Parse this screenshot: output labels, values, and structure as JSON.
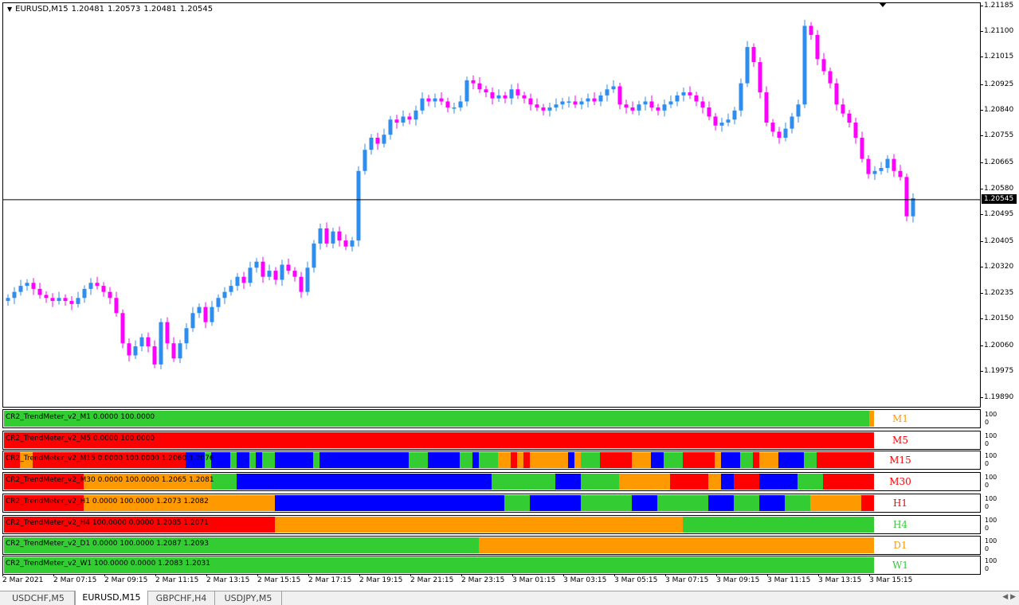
{
  "chart": {
    "symbol": "EURUSD,M15",
    "ohlc": [
      "1.20481",
      "1.20573",
      "1.20481",
      "1.20545"
    ],
    "current_price": "1.20545",
    "up_color": "#2e8ef0",
    "down_color": "#ff00ff",
    "y_min": 1.1986,
    "y_max": 1.21195,
    "y_ticks": [
      "1.21185",
      "1.21100",
      "1.21015",
      "1.20925",
      "1.20840",
      "1.20755",
      "1.20665",
      "1.20580",
      "1.20495",
      "1.20405",
      "1.20320",
      "1.20235",
      "1.20150",
      "1.20060",
      "1.19975",
      "1.19890"
    ]
  },
  "chart_data": {
    "type": "candlestick",
    "title": "EURUSD,M15",
    "ylim": [
      1.1986,
      1.21195
    ],
    "last_price": 1.20545,
    "x_labels": [
      "2 Mar 2021",
      "2 Mar 07:15",
      "2 Mar 09:15",
      "2 Mar 11:15",
      "2 Mar 13:15",
      "2 Mar 15:15",
      "2 Mar 17:15",
      "2 Mar 19:15",
      "2 Mar 21:15",
      "2 Mar 23:15",
      "3 Mar 01:15",
      "3 Mar 03:15",
      "3 Mar 05:15",
      "3 Mar 07:15",
      "3 Mar 09:15",
      "3 Mar 11:15",
      "3 Mar 13:15",
      "3 Mar 15:15"
    ],
    "closes": [
      1.2022,
      1.2024,
      1.2026,
      1.2027,
      1.2025,
      1.2023,
      1.2022,
      1.2021,
      1.2022,
      1.2021,
      1.202,
      1.2022,
      1.2025,
      1.2027,
      1.2026,
      1.2024,
      1.2022,
      1.2017,
      1.2007,
      1.2003,
      1.2006,
      1.2009,
      1.2006,
      1.2,
      1.2014,
      1.2007,
      1.2002,
      1.2007,
      1.2012,
      1.2017,
      1.2019,
      1.2014,
      1.2019,
      1.2022,
      1.2024,
      1.2026,
      1.2029,
      1.2027,
      1.2032,
      1.2034,
      1.2029,
      1.2031,
      1.2028,
      1.2033,
      1.2031,
      1.2029,
      1.2024,
      1.2032,
      1.204,
      1.2045,
      1.204,
      1.2044,
      1.2041,
      1.2039,
      1.2041,
      1.2064,
      1.2071,
      1.2075,
      1.2073,
      1.2076,
      1.2081,
      1.208,
      1.2082,
      1.2081,
      1.2084,
      1.2088,
      1.2087,
      1.2088,
      1.2087,
      1.2085,
      1.2085,
      1.2087,
      1.2094,
      1.2093,
      1.2091,
      1.209,
      1.2088,
      1.2089,
      1.2088,
      1.2091,
      1.2089,
      1.2088,
      1.2086,
      1.2085,
      1.2084,
      1.2085,
      1.2086,
      1.2087,
      1.2087,
      1.2086,
      1.2087,
      1.2088,
      1.2087,
      1.2089,
      1.2091,
      1.2092,
      1.2086,
      1.2085,
      1.2084,
      1.2086,
      1.2087,
      1.2085,
      1.2084,
      1.2086,
      1.2087,
      1.2089,
      1.209,
      1.2089,
      1.2087,
      1.2085,
      1.2082,
      1.2079,
      1.208,
      1.2081,
      1.2084,
      1.2093,
      1.2105,
      1.21,
      1.209,
      1.208,
      1.2077,
      1.2075,
      1.2078,
      1.2082,
      1.2086,
      1.2112,
      1.2109,
      1.2101,
      1.2097,
      1.2093,
      1.2086,
      1.2083,
      1.208,
      1.2075,
      1.2068,
      1.2063,
      1.2064,
      1.2065,
      1.2068,
      1.2064,
      1.2062,
      1.2049,
      1.2055
    ]
  },
  "indicators": [
    {
      "label": "CR2_TrendMeter_v2_M1 0.0000 100.0000",
      "tf": "M1",
      "tf_color": "#ff9900",
      "scale": [
        "100",
        "0"
      ],
      "segments": [
        [
          0,
          1086,
          "#33cc33"
        ],
        [
          1086,
          1092,
          "#ff9900"
        ]
      ]
    },
    {
      "label": "CR2_TrendMeter_v2_M5 0.0000 100.0000",
      "tf": "M5",
      "tf_color": "#ff0000",
      "scale": [
        "100",
        "0"
      ],
      "segments": [
        [
          0,
          1092,
          "#ff0000"
        ]
      ]
    },
    {
      "label": "CR2_TrendMeter_v2_M15 0.0000 100.0000 1.2060 1.2076",
      "tf": "M15",
      "tf_color": "#ff0000",
      "scale": [
        "100",
        "0"
      ],
      "segments": [
        [
          0,
          20,
          "#ff0000"
        ],
        [
          20,
          36,
          "#ff9900"
        ],
        [
          36,
          228,
          "#ff0000"
        ],
        [
          228,
          252,
          "#0000ff"
        ],
        [
          252,
          260,
          "#33cc33"
        ],
        [
          260,
          284,
          "#0000ff"
        ],
        [
          284,
          292,
          "#33cc33"
        ],
        [
          292,
          308,
          "#0000ff"
        ],
        [
          308,
          316,
          "#33cc33"
        ],
        [
          316,
          324,
          "#0000ff"
        ],
        [
          324,
          340,
          "#33cc33"
        ],
        [
          340,
          388,
          "#0000ff"
        ],
        [
          388,
          396,
          "#33cc33"
        ],
        [
          396,
          508,
          "#0000ff"
        ],
        [
          508,
          532,
          "#33cc33"
        ],
        [
          532,
          572,
          "#0000ff"
        ],
        [
          572,
          588,
          "#33cc33"
        ],
        [
          588,
          596,
          "#0000ff"
        ],
        [
          596,
          620,
          "#33cc33"
        ],
        [
          620,
          636,
          "#ff9900"
        ],
        [
          636,
          644,
          "#ff0000"
        ],
        [
          644,
          652,
          "#ff9900"
        ],
        [
          652,
          660,
          "#ff0000"
        ],
        [
          660,
          708,
          "#ff9900"
        ],
        [
          708,
          716,
          "#0000ff"
        ],
        [
          716,
          724,
          "#ff9900"
        ],
        [
          724,
          748,
          "#33cc33"
        ],
        [
          748,
          788,
          "#ff0000"
        ],
        [
          788,
          812,
          "#ff9900"
        ],
        [
          812,
          828,
          "#0000ff"
        ],
        [
          828,
          852,
          "#33cc33"
        ],
        [
          852,
          892,
          "#ff0000"
        ],
        [
          892,
          900,
          "#ff9900"
        ],
        [
          900,
          924,
          "#0000ff"
        ],
        [
          924,
          940,
          "#33cc33"
        ],
        [
          940,
          948,
          "#ff0000"
        ],
        [
          948,
          972,
          "#ff9900"
        ],
        [
          972,
          1004,
          "#0000ff"
        ],
        [
          1004,
          1020,
          "#33cc33"
        ],
        [
          1020,
          1092,
          "#ff0000"
        ]
      ]
    },
    {
      "label": "CR2_TrendMeter_v2_M30 0.0000 100.0000 1.2065 1.2081",
      "tf": "M30",
      "tf_color": "#ff0000",
      "scale": [
        "100",
        "0"
      ],
      "segments": [
        [
          0,
          100,
          "#ff0000"
        ],
        [
          100,
          260,
          "#ff9900"
        ],
        [
          260,
          292,
          "#33cc33"
        ],
        [
          292,
          612,
          "#0000ff"
        ],
        [
          612,
          692,
          "#33cc33"
        ],
        [
          692,
          724,
          "#0000ff"
        ],
        [
          724,
          772,
          "#33cc33"
        ],
        [
          772,
          836,
          "#ff9900"
        ],
        [
          836,
          884,
          "#ff0000"
        ],
        [
          884,
          900,
          "#ff9900"
        ],
        [
          900,
          916,
          "#0000ff"
        ],
        [
          916,
          948,
          "#ff0000"
        ],
        [
          948,
          996,
          "#0000ff"
        ],
        [
          996,
          1028,
          "#33cc33"
        ],
        [
          1028,
          1092,
          "#ff0000"
        ]
      ]
    },
    {
      "label": "CR2_TrendMeter_v2_H1 0.0000 100.0000 1.2073 1.2082",
      "tf": "H1",
      "tf_color": "#ff0000",
      "scale": [
        "100",
        "0"
      ],
      "segments": [
        [
          0,
          100,
          "#ff0000"
        ],
        [
          100,
          340,
          "#ff9900"
        ],
        [
          340,
          628,
          "#0000ff"
        ],
        [
          628,
          660,
          "#33cc33"
        ],
        [
          660,
          724,
          "#0000ff"
        ],
        [
          724,
          788,
          "#33cc33"
        ],
        [
          788,
          820,
          "#0000ff"
        ],
        [
          820,
          884,
          "#33cc33"
        ],
        [
          884,
          916,
          "#0000ff"
        ],
        [
          916,
          948,
          "#33cc33"
        ],
        [
          948,
          980,
          "#0000ff"
        ],
        [
          980,
          1012,
          "#33cc33"
        ],
        [
          1012,
          1076,
          "#ff9900"
        ],
        [
          1076,
          1092,
          "#ff0000"
        ]
      ]
    },
    {
      "label": "CR2_TrendMeter_v2_H4 100.0000 0.0000 1.2085 1.2071",
      "tf": "H4",
      "tf_color": "#33cc33",
      "scale": [
        "100",
        "0"
      ],
      "segments": [
        [
          0,
          340,
          "#ff0000"
        ],
        [
          340,
          852,
          "#ff9900"
        ],
        [
          852,
          1092,
          "#33cc33"
        ]
      ]
    },
    {
      "label": "CR2_TrendMeter_v2_D1 0.0000 100.0000 1.2087 1.2093",
      "tf": "D1",
      "tf_color": "#ff9900",
      "scale": [
        "100",
        "0"
      ],
      "segments": [
        [
          0,
          596,
          "#33cc33"
        ],
        [
          596,
          1092,
          "#ff9900"
        ]
      ]
    },
    {
      "label": "CR2_TrendMeter_v2_W1 100.0000 0.0000 1.2083 1.2031",
      "tf": "W1",
      "tf_color": "#33cc33",
      "scale": [
        "100",
        "0"
      ],
      "segments": [
        [
          0,
          1092,
          "#33cc33"
        ]
      ]
    }
  ],
  "time_axis": [
    "2 Mar 2021",
    "2 Mar 07:15",
    "2 Mar 09:15",
    "2 Mar 11:15",
    "2 Mar 13:15",
    "2 Mar 15:15",
    "2 Mar 17:15",
    "2 Mar 19:15",
    "2 Mar 21:15",
    "2 Mar 23:15",
    "3 Mar 01:15",
    "3 Mar 03:15",
    "3 Mar 05:15",
    "3 Mar 07:15",
    "3 Mar 09:15",
    "3 Mar 11:15",
    "3 Mar 13:15",
    "3 Mar 15:15"
  ],
  "tabs": [
    {
      "label": "USDCHF,M5",
      "active": false
    },
    {
      "label": "EURUSD,M15",
      "active": true
    },
    {
      "label": "GBPCHF,H4",
      "active": false
    },
    {
      "label": "USDJPY,M5",
      "active": false
    }
  ]
}
